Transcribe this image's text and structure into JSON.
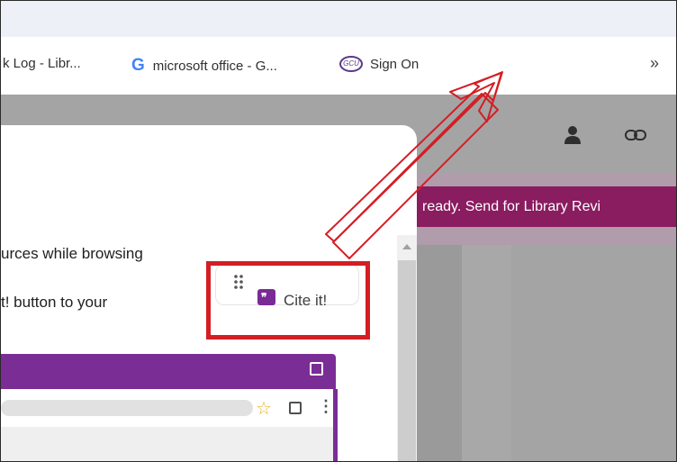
{
  "bookmarks": {
    "items": [
      {
        "label": "k Log - Libr..."
      },
      {
        "icon": "google-icon",
        "label": "microsoft office - G..."
      },
      {
        "icon": "gcu-icon",
        "icon_text": "GCU",
        "label": "Sign On"
      }
    ],
    "overflow_label": "»"
  },
  "app": {
    "banner_text": "ready. Send for Library Revi"
  },
  "popup": {
    "line1": "urces while browsing",
    "line2": "t! button to your",
    "cite_button_label": "Cite it!"
  },
  "colors": {
    "accent_purple": "#7b2d96",
    "banner_magenta": "#8a1c60",
    "highlight_red": "#d41e24"
  }
}
